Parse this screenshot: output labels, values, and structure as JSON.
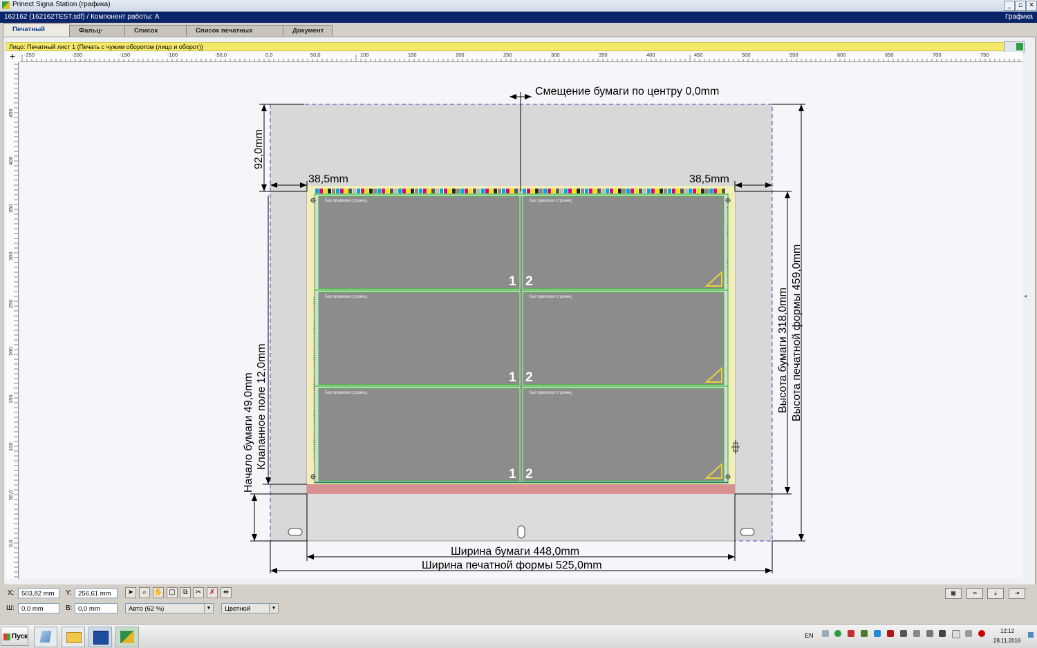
{
  "window": {
    "title": "Prinect Signa Station (графика)",
    "controls": [
      "_",
      "▫",
      "✕"
    ]
  },
  "docbar": {
    "left": "162162 (162162TEST.sdf) / Компонент работы: A",
    "right": "Графика"
  },
  "tabs": [
    "Печатный лист",
    "Фальц-лист",
    "Список полос",
    "Список печатных листов",
    "Документ"
  ],
  "active_tab": "Печатный лист",
  "infobar": "Лицо:  Печатный лист 1 (Печать с чужим оборотом (лицо и оборот))",
  "ruler": {
    "h_labels": [
      "-250",
      "-200",
      "-150",
      "-100",
      "-50,0",
      "0,0",
      "50,0",
      "100",
      "150",
      "200",
      "250",
      "300",
      "350",
      "400",
      "450",
      "500",
      "550",
      "600",
      "650",
      "700",
      "750"
    ],
    "v_labels": [
      "450",
      "400",
      "350",
      "300",
      "250",
      "200",
      "150",
      "100",
      "50,0",
      "0,0"
    ]
  },
  "sheet": {
    "cell_label": "Без привязки страниц",
    "page_left": "1",
    "page_right": "2"
  },
  "dimensions": {
    "top_center": "Смещение бумаги по центру 0,0mm",
    "top_gap": "92,0mm",
    "left_margin": "38,5mm",
    "right_margin": "38,5mm",
    "gripper": "Клапанное поле 12,0mm",
    "paper_start": "Начало бумаги 49,0mm",
    "paper_height": "Высота бумаги 318,0mm",
    "form_height": "Высота печатной формы 459,0mm",
    "paper_width": "Ширина бумаги 448,0mm",
    "form_width": "Ширина печатной формы 525,0mm"
  },
  "controls": {
    "x_label": "X:",
    "x_value": "503,82 mm",
    "y_label": "Y:",
    "y_value": "256,61 mm",
    "w_label": "Ш:",
    "w_value": "0,0 mm",
    "h_label": "В:",
    "h_value": "0,0 mm",
    "zoom": "Авто (62 %)",
    "color_mode": "Цветной"
  },
  "taskbar": {
    "start": "Пуск",
    "lang": "EN",
    "time": "12:12",
    "date": "28.11.2016"
  },
  "colors": {
    "titlebar_blue": "#0a246a",
    "infobar_yellow": "#f5e96c",
    "plate_gray": "#d8d8d8",
    "cell_gray": "#8c8c8c",
    "accent_green": "#35c235",
    "gripper_red": "#d99090"
  }
}
